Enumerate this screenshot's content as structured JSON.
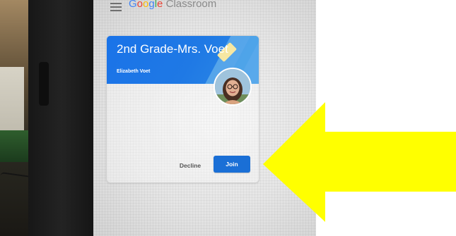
{
  "app": {
    "brand_letters": [
      {
        "text": "G",
        "color": "#4285f4"
      },
      {
        "text": "o",
        "color": "#ea4335"
      },
      {
        "text": "o",
        "color": "#fbbc05"
      },
      {
        "text": "g",
        "color": "#4285f4"
      },
      {
        "text": "l",
        "color": "#34a853"
      },
      {
        "text": "e",
        "color": "#ea4335"
      }
    ],
    "brand_product": "Classroom",
    "menu_icon": "menu-hamburger-icon"
  },
  "invite_card": {
    "class_name": "2nd Grade-Mrs. Voet",
    "teacher": "Elizabeth Voet",
    "avatar_icon": "teacher-photo-avatar",
    "header_color": "#1a73e8",
    "actions": {
      "decline_label": "Decline",
      "join_label": "Join",
      "join_color": "#1a6fd6"
    }
  },
  "annotation": {
    "arrow_icon": "yellow-left-arrow-icon",
    "arrow_color": "#ffff00"
  }
}
